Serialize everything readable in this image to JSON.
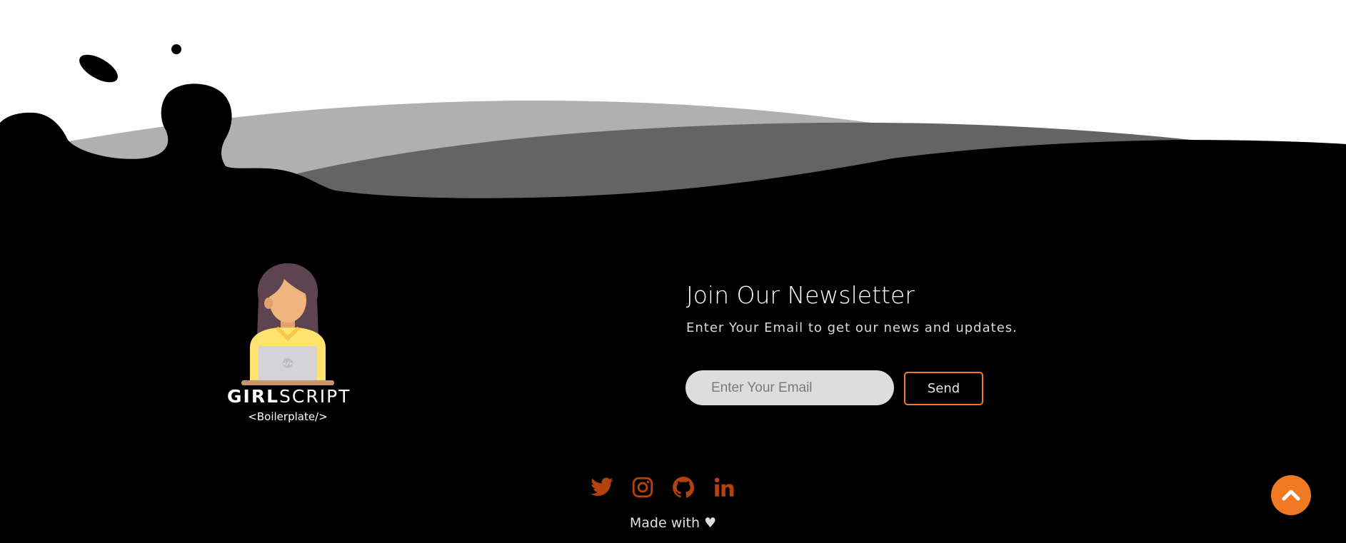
{
  "brand": {
    "wordmark_bold": "GIRL",
    "wordmark_light": "SCRIPT",
    "subtitle": "<Boilerplate/>",
    "laptop_mark": "</>"
  },
  "newsletter": {
    "title": "Join Our Newsletter",
    "subtitle": "Enter Your Email to get our news and updates.",
    "email_placeholder": "Enter Your Email",
    "email_value": "",
    "send_label": "Send"
  },
  "social": {
    "items": [
      {
        "name": "twitter",
        "icon": "twitter-icon"
      },
      {
        "name": "instagram",
        "icon": "instagram-icon"
      },
      {
        "name": "github",
        "icon": "github-icon"
      },
      {
        "name": "linkedin",
        "icon": "linkedin-icon"
      }
    ],
    "color": "#b5410f"
  },
  "footer": {
    "made_with": "Made with ♥"
  },
  "scroll_top": {
    "icon": "chevron-up-icon"
  },
  "colors": {
    "accent": "#f07a21",
    "background": "#000000",
    "wave_light": "#b0b0b0",
    "wave_mid": "#646464"
  }
}
